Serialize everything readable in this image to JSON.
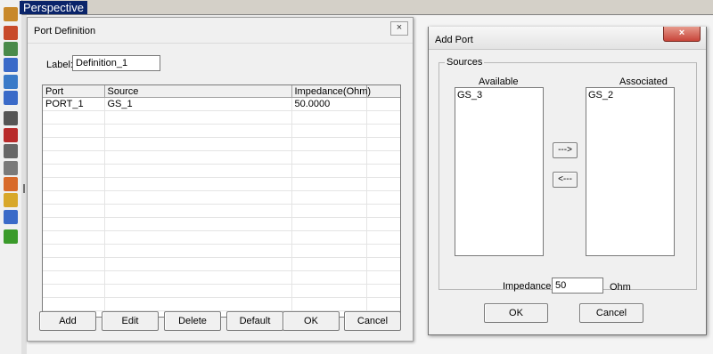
{
  "perspective": {
    "title": "Perspective"
  },
  "toolbar": {
    "icons": [
      {
        "name": "ruler-icon",
        "color": "#c8882a"
      },
      {
        "name": "scissors-icon",
        "color": "#c84a2a"
      },
      {
        "name": "copy-icon",
        "color": "#4a8a4a"
      },
      {
        "name": "3d-box-icon",
        "color": "#3a6ac8"
      },
      {
        "name": "grid-icon",
        "color": "#3a7ac8"
      },
      {
        "name": "table-icon",
        "color": "#3a6ac8"
      },
      {
        "name": "function-icon",
        "color": "#555555"
      },
      {
        "name": "excel-icon",
        "color": "#b82a2a"
      },
      {
        "name": "matrix-icon",
        "color": "#666666"
      },
      {
        "name": "image-icon",
        "color": "#7a7a7a"
      },
      {
        "name": "check-icon",
        "color": "#d86a2a"
      },
      {
        "name": "paste-icon",
        "color": "#d8a82a"
      },
      {
        "name": "calculator-icon",
        "color": "#3a6ac8"
      },
      {
        "name": "star-icon",
        "color": "#3a9a2a"
      }
    ]
  },
  "port_definition": {
    "title": "Port Definition",
    "close_label": "×",
    "label_caption": "Label:",
    "label_value": "Definition_1",
    "columns": [
      "Port",
      "Source",
      "Impedance(Ohm)",
      ""
    ],
    "rows": [
      [
        "PORT_1",
        "GS_1",
        "50.0000",
        ""
      ]
    ],
    "buttons": {
      "add": "Add",
      "edit": "Edit",
      "delete": "Delete",
      "default": "Default",
      "ok": "OK",
      "cancel": "Cancel"
    }
  },
  "add_port": {
    "title": "Add Port",
    "close_label": "×",
    "sources_label": "Sources",
    "available_label": "Available",
    "associated_label": "Associated",
    "available_items": [
      "GS_3"
    ],
    "associated_items": [
      "GS_2"
    ],
    "move_right_label": "--->",
    "move_left_label": "<---",
    "impedance_label": "Impedance:",
    "impedance_value": "50",
    "impedance_unit": "Ohm",
    "ok_label": "OK",
    "cancel_label": "Cancel"
  }
}
